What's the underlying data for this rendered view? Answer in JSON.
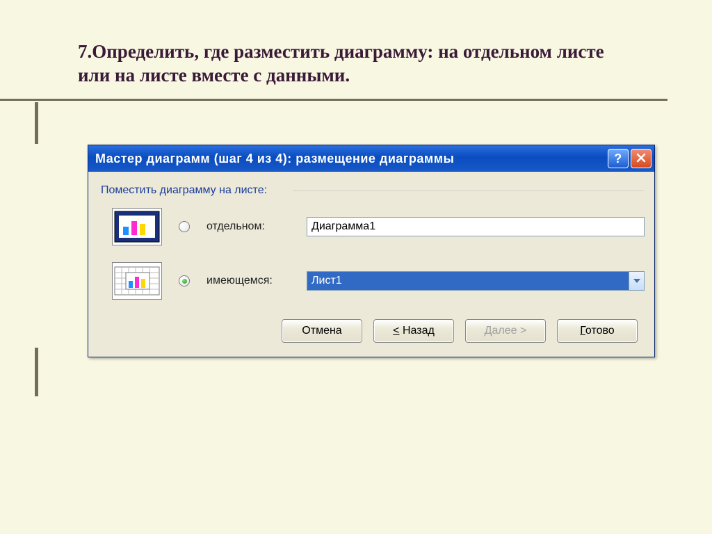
{
  "slide": {
    "heading": "7.Определить, где разместить диаграмму: на отдельном листе или на листе вместе с данными."
  },
  "dialog": {
    "title": "Мастер диаграмм (шаг 4 из 4): размещение диаграммы",
    "group_label": "Поместить диаграмму на листе:",
    "options": {
      "separate": {
        "label": "отдельном:",
        "value": "Диаграмма1",
        "checked": false
      },
      "existing": {
        "label": "имеющемся:",
        "value": "Лист1",
        "checked": true
      }
    },
    "buttons": {
      "cancel": "Отмена",
      "back": "< Назад",
      "next": "Далее >",
      "finish": "Готово"
    }
  }
}
